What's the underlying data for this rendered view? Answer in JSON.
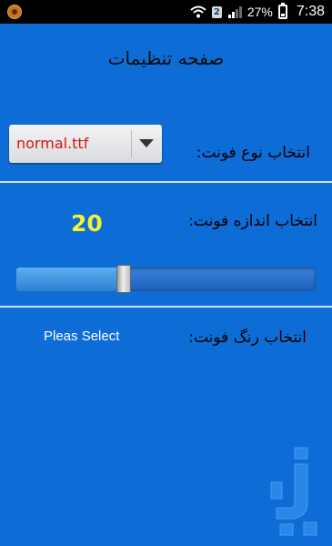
{
  "status_bar": {
    "sim_number": "2",
    "battery_percent": "27%",
    "battery_level": 0.27,
    "time": "7:38",
    "icons": [
      "app-notification-icon",
      "wifi-icon",
      "sim-badge",
      "signal-icon",
      "battery-icon"
    ]
  },
  "page": {
    "title": "صفحه تنظیمات"
  },
  "font_type": {
    "label": "انتخاب نوع فونت:",
    "selected": "normal.ttf"
  },
  "font_size": {
    "label": "انتخاب اندازه فونت:",
    "value": "20",
    "slider_fraction": 0.36
  },
  "font_color": {
    "label": "انتخاب رنگ فونت:",
    "select_prompt": "Pleas Select"
  },
  "colors": {
    "background": "#0e6cd6",
    "size_value": "#f5f232",
    "spinner_text": "#e01010"
  }
}
